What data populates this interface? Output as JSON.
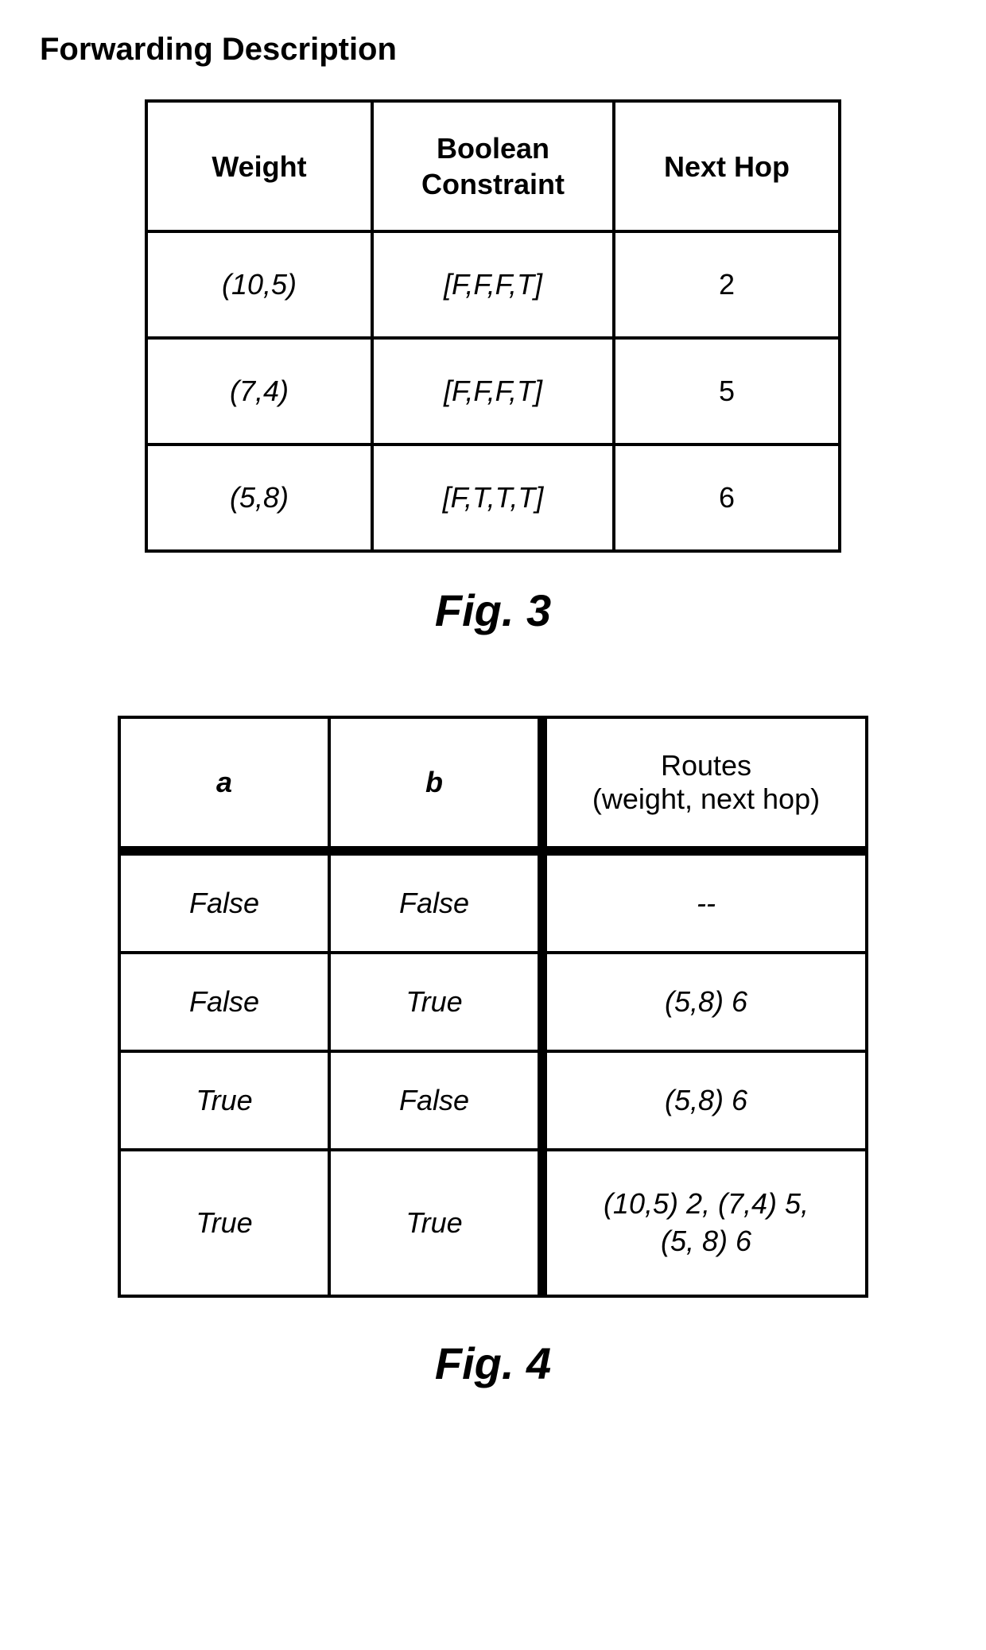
{
  "title": "Forwarding Description",
  "fig3": {
    "headers": {
      "weight": "Weight",
      "bool": "Boolean\nConstraint",
      "next": "Next Hop"
    },
    "rows": [
      {
        "weight": "(10,5)",
        "bool": "[F,F,F,T]",
        "next": "2"
      },
      {
        "weight": "(7,4)",
        "bool": "[F,F,F,T]",
        "next": "5"
      },
      {
        "weight": "(5,8)",
        "bool": "[F,T,T,T]",
        "next": "6"
      }
    ],
    "caption": "Fig. 3"
  },
  "fig4": {
    "headers": {
      "a": "a",
      "b": "b",
      "routes": "Routes\n(weight, next hop)"
    },
    "rows": [
      {
        "a": "False",
        "b": "False",
        "routes": "--"
      },
      {
        "a": "False",
        "b": "True",
        "routes": "(5,8) 6"
      },
      {
        "a": "True",
        "b": "False",
        "routes": "(5,8) 6"
      },
      {
        "a": "True",
        "b": "True",
        "routes": "(10,5) 2, (7,4) 5,\n(5, 8) 6"
      }
    ],
    "caption": "Fig. 4"
  }
}
